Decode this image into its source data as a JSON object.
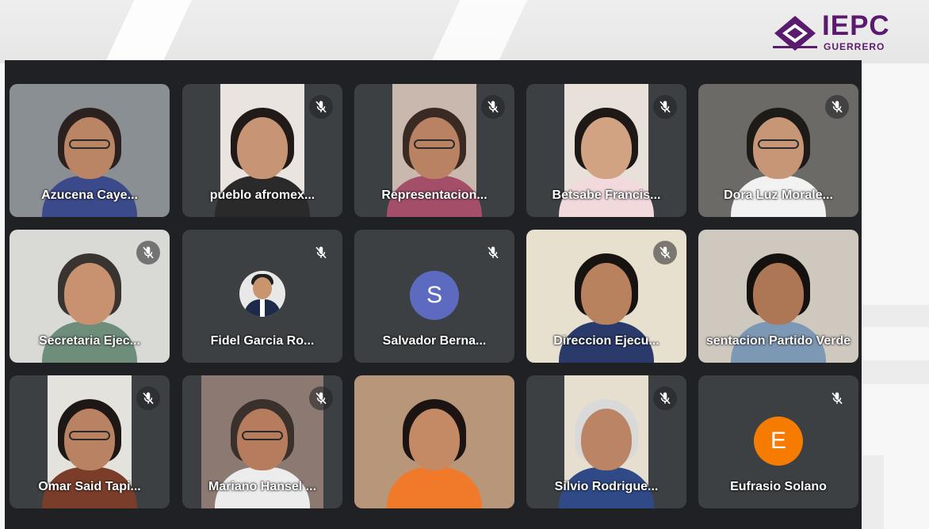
{
  "branding": {
    "logo_text": "IEPC",
    "logo_subtext": "GUERRERO",
    "brand_color": "#5a1a6e"
  },
  "meeting": {
    "background_color": "#202124",
    "tile_color": "#3c4043",
    "participants": [
      {
        "name": "Azucena Caye...",
        "muted": false,
        "type": "video",
        "bg": "#8a8f93",
        "skin": "#b98565",
        "hair": "#2b2220",
        "shirt": "#3b4a8a",
        "glasses": true,
        "width": "full"
      },
      {
        "name": "pueblo afromex...",
        "muted": true,
        "type": "video",
        "bg": "#e9e4df",
        "skin": "#c79575",
        "hair": "#211a18",
        "shirt": "#2a2a2a",
        "glasses": false,
        "width": "narrow"
      },
      {
        "name": "Representacion...",
        "muted": true,
        "type": "video",
        "bg": "#c9b8ae",
        "skin": "#b98363",
        "hair": "#3a2a24",
        "shirt": "#a44e6a",
        "glasses": true,
        "width": "narrow"
      },
      {
        "name": "Betsabe Francis...",
        "muted": true,
        "type": "video",
        "bg": "#e8e1da",
        "skin": "#d2a383",
        "hair": "#1e1816",
        "shirt": "#f1d9dc",
        "glasses": false,
        "width": "narrow"
      },
      {
        "name": "Dora Luz Morale...",
        "muted": true,
        "type": "video",
        "bg": "#6c6a66",
        "skin": "#c69677",
        "hair": "#1e1a18",
        "shirt": "#f2f2f2",
        "glasses": true,
        "width": "full"
      },
      {
        "name": "Secretaria Ejec...",
        "muted": true,
        "type": "video",
        "bg": "#d9d9d6",
        "skin": "#c8916f",
        "hair": "#3a3430",
        "shirt": "#6f8d7b",
        "glasses": false,
        "width": "full"
      },
      {
        "name": "Fidel Garcia Ro...",
        "muted": true,
        "type": "photo-avatar"
      },
      {
        "name": "Salvador Berna...",
        "muted": true,
        "type": "letter-avatar",
        "letter": "S",
        "avatar_color": "#5c6bc0"
      },
      {
        "name": "Direccion Ejecu...",
        "muted": true,
        "type": "video",
        "bg": "#e7e0cf",
        "skin": "#b9825f",
        "hair": "#161311",
        "shirt": "#2a3a6a",
        "glasses": false,
        "width": "full"
      },
      {
        "name": "sentacion Partido Verde",
        "muted": false,
        "type": "video",
        "bg": "#cfc8bf",
        "skin": "#ad7654",
        "hair": "#15110f",
        "shirt": "#7d98b5",
        "glasses": false,
        "width": "full"
      },
      {
        "name": "Omar Said Tapi...",
        "muted": true,
        "type": "video",
        "bg": "#e4e2dc",
        "skin": "#b98363",
        "hair": "#1d1816",
        "shirt": "#7a3d2a",
        "glasses": true,
        "width": "narrow"
      },
      {
        "name": "Mariano Hansel ...",
        "muted": true,
        "type": "video",
        "bg": "#8c7a72",
        "skin": "#b57d5d",
        "hair": "#3a302c",
        "shirt": "#ececec",
        "glasses": true,
        "width": "mid"
      },
      {
        "name": "",
        "muted": false,
        "type": "video",
        "bg": "#b8967a",
        "skin": "#c48a66",
        "hair": "#1b1412",
        "shirt": "#f07a2a",
        "glasses": false,
        "width": "full"
      },
      {
        "name": "Silvio Rodrigue...",
        "muted": true,
        "type": "video",
        "bg": "#e6dfcf",
        "skin": "#bb8565",
        "hair": "#d9d9d9",
        "shirt": "#2f4a86",
        "glasses": false,
        "width": "narrow"
      },
      {
        "name": "Eufrasio Solano",
        "muted": true,
        "type": "letter-avatar",
        "letter": "E",
        "avatar_color": "#f57c00"
      }
    ]
  }
}
